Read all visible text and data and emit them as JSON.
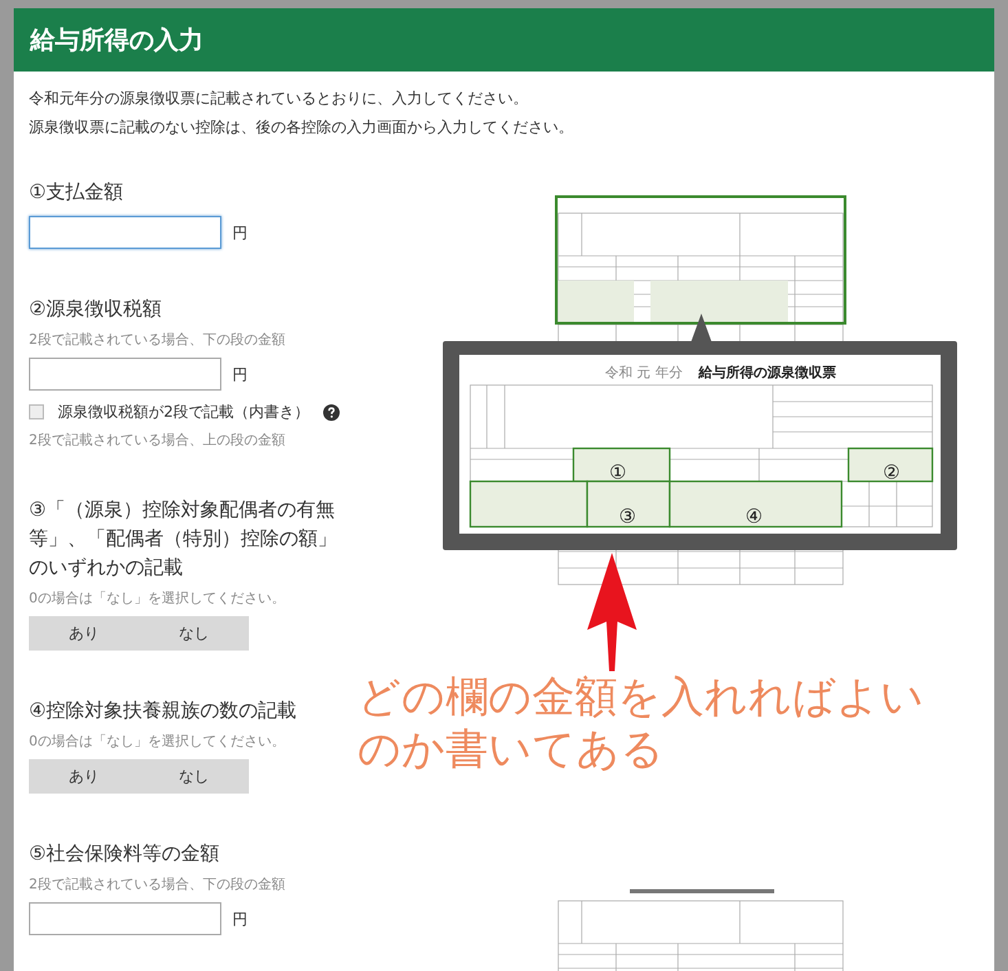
{
  "dialog": {
    "title": "給与所得の入力",
    "intro": [
      "令和元年分の源泉徴収票に記載されているとおりに、入力してください。",
      "源泉徴収票に記載のない控除は、後の各控除の入力画面から入力してください。"
    ]
  },
  "fields": [
    {
      "kind": "amount",
      "label": "①支払金額",
      "focused": true,
      "unit": "円"
    },
    {
      "kind": "amount",
      "label": "②源泉徴収税額",
      "hint": "2段で記載されている場合、下の段の金額",
      "focused": false,
      "unit": "円",
      "checkbox": {
        "label": "源泉徴収税額が2段で記載（内書き）",
        "checked": false
      },
      "note": "2段で記載されている場合、上の段の金額"
    },
    {
      "kind": "choice",
      "label": "③「（源泉）控除対象配偶者の有無等」、「配偶者（特別）控除の額」のいずれかの記載",
      "hint": "0の場合は「なし」を選択してください。",
      "options": [
        {
          "label": "あり",
          "selected": false
        },
        {
          "label": "なし",
          "selected": false
        }
      ]
    },
    {
      "kind": "choice",
      "label": "④控除対象扶養親族の数の記載",
      "hint": "0の場合は「なし」を選択してください。",
      "options": [
        {
          "label": "あり",
          "selected": false
        },
        {
          "label": "なし",
          "selected": false
        }
      ]
    },
    {
      "kind": "amount",
      "label": "⑤社会保険料等の金額",
      "hint": "2段で記載されている場合、下の段の金額",
      "focused": false,
      "unit": "円"
    }
  ],
  "callout": {
    "year_label": "令和 元 年分",
    "title": "給与所得の源泉徴収票",
    "markers": [
      "①",
      "②",
      "③",
      "④"
    ]
  },
  "annotation": {
    "color": "#ee8a5e",
    "lines": [
      "どの欄の金額を入れればよい",
      "のか書いてある"
    ]
  }
}
